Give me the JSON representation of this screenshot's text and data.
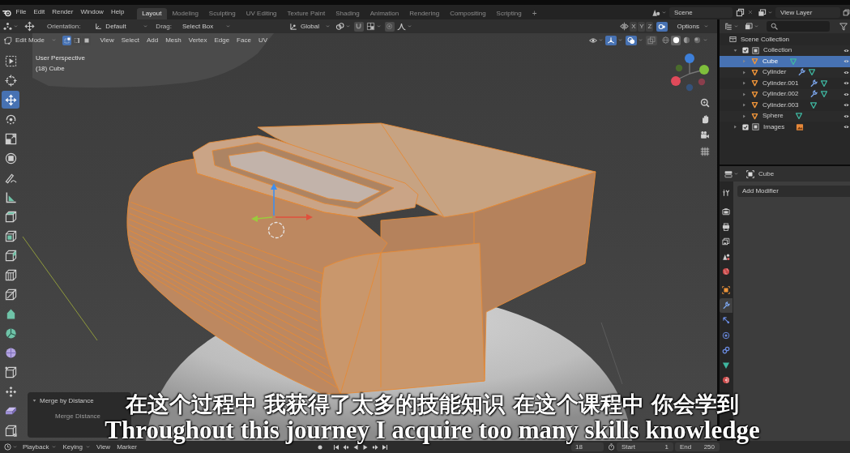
{
  "topbar": {
    "menus": [
      "File",
      "Edit",
      "Render",
      "Window",
      "Help"
    ],
    "workspaces": [
      {
        "label": "Layout",
        "selected": true
      },
      {
        "label": "Modeling",
        "selected": false
      },
      {
        "label": "Sculpting",
        "selected": false
      },
      {
        "label": "UV Editing",
        "selected": false
      },
      {
        "label": "Texture Paint",
        "selected": false
      },
      {
        "label": "Shading",
        "selected": false
      },
      {
        "label": "Animation",
        "selected": false
      },
      {
        "label": "Rendering",
        "selected": false
      },
      {
        "label": "Compositing",
        "selected": false
      },
      {
        "label": "Scripting",
        "selected": false
      }
    ],
    "add_workspace": "+",
    "scene": "Scene",
    "view_layer": "View Layer"
  },
  "tool_header": {
    "orientation_label": "Orientation:",
    "orientation": "Default",
    "drag_label": "Drag:",
    "drag": "Select Box",
    "transform_orientation": "Global",
    "toggles": [
      {
        "kind": "snap",
        "on": false
      },
      {
        "kind": "proportional",
        "on": false
      }
    ],
    "mirror_axes": [
      {
        "label": "X",
        "on": false
      },
      {
        "label": "Y",
        "on": false
      },
      {
        "label": "Z",
        "on": false
      }
    ],
    "auto_merge": true,
    "options": "Options"
  },
  "viewport_header": {
    "mode": "Edit Mode",
    "select_modes": [
      {
        "kind": "vertex",
        "selected": true
      },
      {
        "kind": "edge",
        "selected": false
      },
      {
        "kind": "face",
        "selected": false
      }
    ],
    "menus": [
      "View",
      "Select",
      "Add",
      "Mesh",
      "Vertex",
      "Edge",
      "Face",
      "UV"
    ],
    "overlay_toggles": [
      {
        "kind": "gizmos",
        "on": true
      },
      {
        "kind": "overlays",
        "on": true
      },
      {
        "kind": "xray",
        "on": false
      }
    ],
    "shading": [
      {
        "kind": "wireframe",
        "selected": false
      },
      {
        "kind": "solid",
        "selected": true
      },
      {
        "kind": "material",
        "selected": false
      },
      {
        "kind": "rendered",
        "selected": false
      }
    ]
  },
  "viewport": {
    "view_name": "User Perspective",
    "object_info": "(18) Cube",
    "tools": [
      {
        "kind": "select-box",
        "selected": false
      },
      {
        "kind": "cursor",
        "selected": false
      },
      {
        "kind": "move",
        "selected": true
      },
      {
        "kind": "rotate",
        "selected": false
      },
      {
        "kind": "scale",
        "selected": false
      },
      {
        "kind": "transform",
        "selected": false
      },
      {
        "kind": "annotate",
        "selected": false
      },
      {
        "kind": "measure",
        "selected": false
      },
      {
        "kind": "extrude",
        "selected": false
      },
      {
        "kind": "inset",
        "selected": false
      },
      {
        "kind": "bevel",
        "selected": false
      },
      {
        "kind": "loop-cut",
        "selected": false
      },
      {
        "kind": "knife",
        "selected": false
      },
      {
        "kind": "poly-build",
        "selected": false
      },
      {
        "kind": "spin",
        "selected": false
      },
      {
        "kind": "smooth",
        "selected": false
      },
      {
        "kind": "edge-slide",
        "selected": false
      },
      {
        "kind": "shrink-fatten",
        "selected": false
      },
      {
        "kind": "shear",
        "selected": false
      },
      {
        "kind": "rip",
        "selected": false
      }
    ],
    "last_operator": {
      "title": "Merge by Distance",
      "expanded": true,
      "field_label": "Merge Distance"
    }
  },
  "outliner": {
    "tree": [
      {
        "label": "Scene Collection",
        "kind": "scene-collection",
        "selected": false,
        "children": [
          {
            "label": "Collection",
            "kind": "collection",
            "selected": false,
            "checked": true,
            "expanded": true,
            "children": [
              {
                "label": "Cube",
                "kind": "mesh",
                "selected": true,
                "expanded": false,
                "badges": [
                  {
                    "kind": "mesh-data"
                  }
                ]
              },
              {
                "label": "Cylinder",
                "kind": "mesh",
                "selected": false,
                "expanded": false,
                "badges": [
                  {
                    "kind": "modifier"
                  },
                  {
                    "kind": "mesh-data"
                  }
                ]
              },
              {
                "label": "Cylinder.001",
                "kind": "mesh",
                "selected": false,
                "expanded": false,
                "badges": [
                  {
                    "kind": "modifier"
                  },
                  {
                    "kind": "mesh-data"
                  }
                ]
              },
              {
                "label": "Cylinder.002",
                "kind": "mesh",
                "selected": false,
                "expanded": false,
                "badges": [
                  {
                    "kind": "modifier"
                  },
                  {
                    "kind": "mesh-data"
                  }
                ]
              },
              {
                "label": "Cylinder.003",
                "kind": "mesh",
                "selected": false,
                "expanded": false,
                "badges": [
                  {
                    "kind": "mesh-data"
                  }
                ]
              },
              {
                "label": "Sphere",
                "kind": "mesh",
                "selected": false,
                "expanded": false,
                "badges": [
                  {
                    "kind": "mesh-data"
                  }
                ]
              }
            ]
          },
          {
            "label": "Images",
            "kind": "collection",
            "selected": false,
            "checked": true,
            "expanded": false,
            "badges": [
              {
                "kind": "image"
              }
            ]
          }
        ]
      }
    ]
  },
  "properties": {
    "object": "Cube",
    "tab_groups": [
      [
        {
          "kind": "tool",
          "selected": false
        }
      ],
      [
        {
          "kind": "render",
          "selected": false
        },
        {
          "kind": "output",
          "selected": false
        },
        {
          "kind": "view-layer",
          "selected": false
        },
        {
          "kind": "scene",
          "selected": false
        },
        {
          "kind": "world",
          "selected": false
        }
      ],
      [
        {
          "kind": "object",
          "selected": false
        },
        {
          "kind": "modifier",
          "selected": true
        },
        {
          "kind": "particles",
          "selected": false
        },
        {
          "kind": "physics",
          "selected": false
        },
        {
          "kind": "constraints",
          "selected": false
        },
        {
          "kind": "data",
          "selected": false
        },
        {
          "kind": "material",
          "selected": false
        }
      ]
    ],
    "add_modifier": "Add Modifier"
  },
  "subtitles": [
    "在这个过程中 我获得了太多的技能知识 在这个课程中 你会学到",
    "Throughout this journey I acquire too many skills knowledge"
  ],
  "timeline": {
    "dropdowns": [
      "Playback",
      "Keying"
    ],
    "menus": [
      "View",
      "Marker"
    ],
    "current_frame": "18",
    "start_label": "Start",
    "start": "1",
    "end_label": "End",
    "end": "250"
  }
}
